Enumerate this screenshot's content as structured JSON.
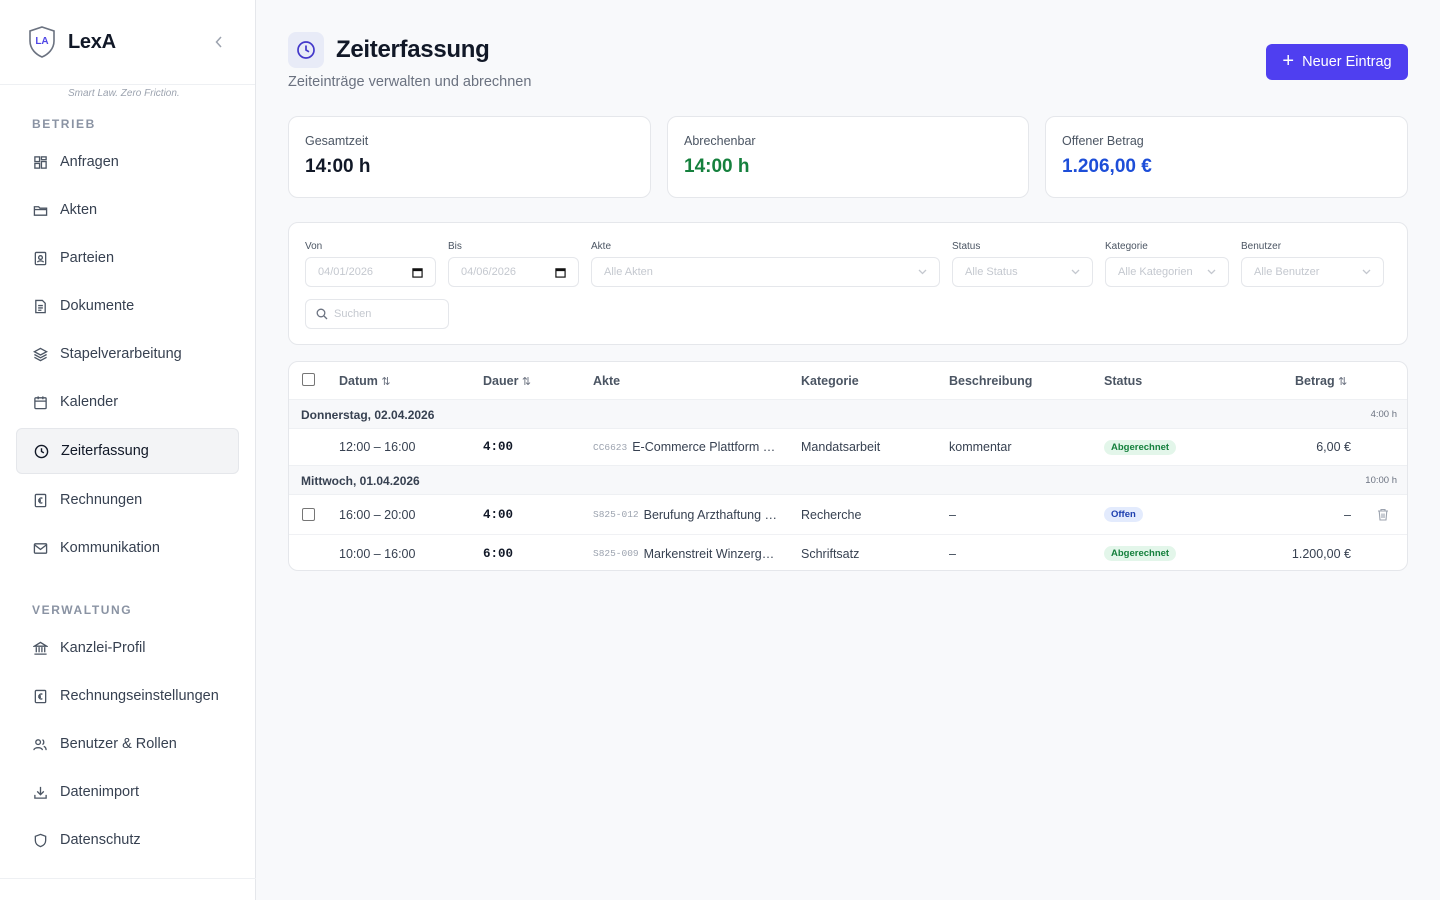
{
  "app": {
    "name": "LexA",
    "logo_text": "LA",
    "tagline": "Smart Law. Zero Friction."
  },
  "sidebar": {
    "sections": [
      {
        "label": "BETRIEB",
        "items": [
          {
            "label": "Anfragen",
            "icon": "grid-icon"
          },
          {
            "label": "Akten",
            "icon": "folder-icon"
          },
          {
            "label": "Parteien",
            "icon": "contact-icon"
          },
          {
            "label": "Dokumente",
            "icon": "document-icon"
          },
          {
            "label": "Stapelverarbeitung",
            "icon": "layers-icon"
          },
          {
            "label": "Kalender",
            "icon": "calendar-icon"
          },
          {
            "label": "Zeiterfassung",
            "icon": "clock-icon",
            "active": true
          },
          {
            "label": "Rechnungen",
            "icon": "invoice-icon"
          },
          {
            "label": "Kommunikation",
            "icon": "mail-icon"
          }
        ]
      },
      {
        "label": "VERWALTUNG",
        "items": [
          {
            "label": "Kanzlei-Profil",
            "icon": "bank-icon"
          },
          {
            "label": "Rechnungseinstellungen",
            "icon": "invoice-settings-icon"
          },
          {
            "label": "Benutzer & Rollen",
            "icon": "users-icon"
          },
          {
            "label": "Datenimport",
            "icon": "download-icon"
          },
          {
            "label": "Datenschutz",
            "icon": "shield-icon"
          }
        ]
      }
    ]
  },
  "header": {
    "title": "Zeiterfassung",
    "subtitle": "Zeiteinträge verwalten und abrechnen",
    "new_button": "Neuer Eintrag"
  },
  "stats": [
    {
      "label": "Gesamtzeit",
      "value": "14:00 h",
      "color": "#111827"
    },
    {
      "label": "Abrechenbar",
      "value": "14:00 h",
      "color": "#15803d"
    },
    {
      "label": "Offener Betrag",
      "value": "1.206,00 €",
      "color": "#1d4ed8"
    }
  ],
  "filters": {
    "from": {
      "label": "Von",
      "value": "04/01/2026"
    },
    "to": {
      "label": "Bis",
      "value": "04/06/2026"
    },
    "file": {
      "label": "Akte",
      "value": "Alle Akten"
    },
    "status": {
      "label": "Status",
      "value": "Alle Status"
    },
    "category": {
      "label": "Kategorie",
      "value": "Alle Kategorien"
    },
    "user": {
      "label": "Benutzer",
      "value": "Alle Benutzer"
    },
    "search_placeholder": "Suchen"
  },
  "table": {
    "columns": {
      "date": "Datum",
      "duration": "Dauer",
      "file": "Akte",
      "category": "Kategorie",
      "description": "Beschreibung",
      "status": "Status",
      "amount": "Betrag"
    },
    "groups": [
      {
        "date": "Donnerstag, 02.04.2026",
        "total": "4:00 h",
        "rows": [
          {
            "time": "12:00 – 16:00",
            "duration": "4:00",
            "code": "CC6623",
            "file": "E-Commerce Plattform …",
            "category": "Mandatsarbeit",
            "description": "kommentar",
            "status": "Abgerechnet",
            "status_kind": "green",
            "amount": "6,00 €",
            "selectable": false,
            "deletable": false
          }
        ]
      },
      {
        "date": "Mittwoch, 01.04.2026",
        "total": "10:00 h",
        "rows": [
          {
            "time": "16:00 – 20:00",
            "duration": "4:00",
            "code": "S825-012",
            "file": "Berufung Arzthaftung …",
            "category": "Recherche",
            "description": "–",
            "status": "Offen",
            "status_kind": "blue",
            "amount": "–",
            "selectable": true,
            "deletable": true
          },
          {
            "time": "10:00 – 16:00",
            "duration": "6:00",
            "code": "S825-009",
            "file": "Markenstreit Winzerg…",
            "category": "Schriftsatz",
            "description": "–",
            "status": "Abgerechnet",
            "status_kind": "green",
            "amount": "1.200,00 €",
            "selectable": false,
            "deletable": false
          }
        ]
      }
    ]
  },
  "colors": {
    "accent": "#4f3ff0",
    "billed_green": "#15803d",
    "open_blue": "#1d4ed8"
  }
}
